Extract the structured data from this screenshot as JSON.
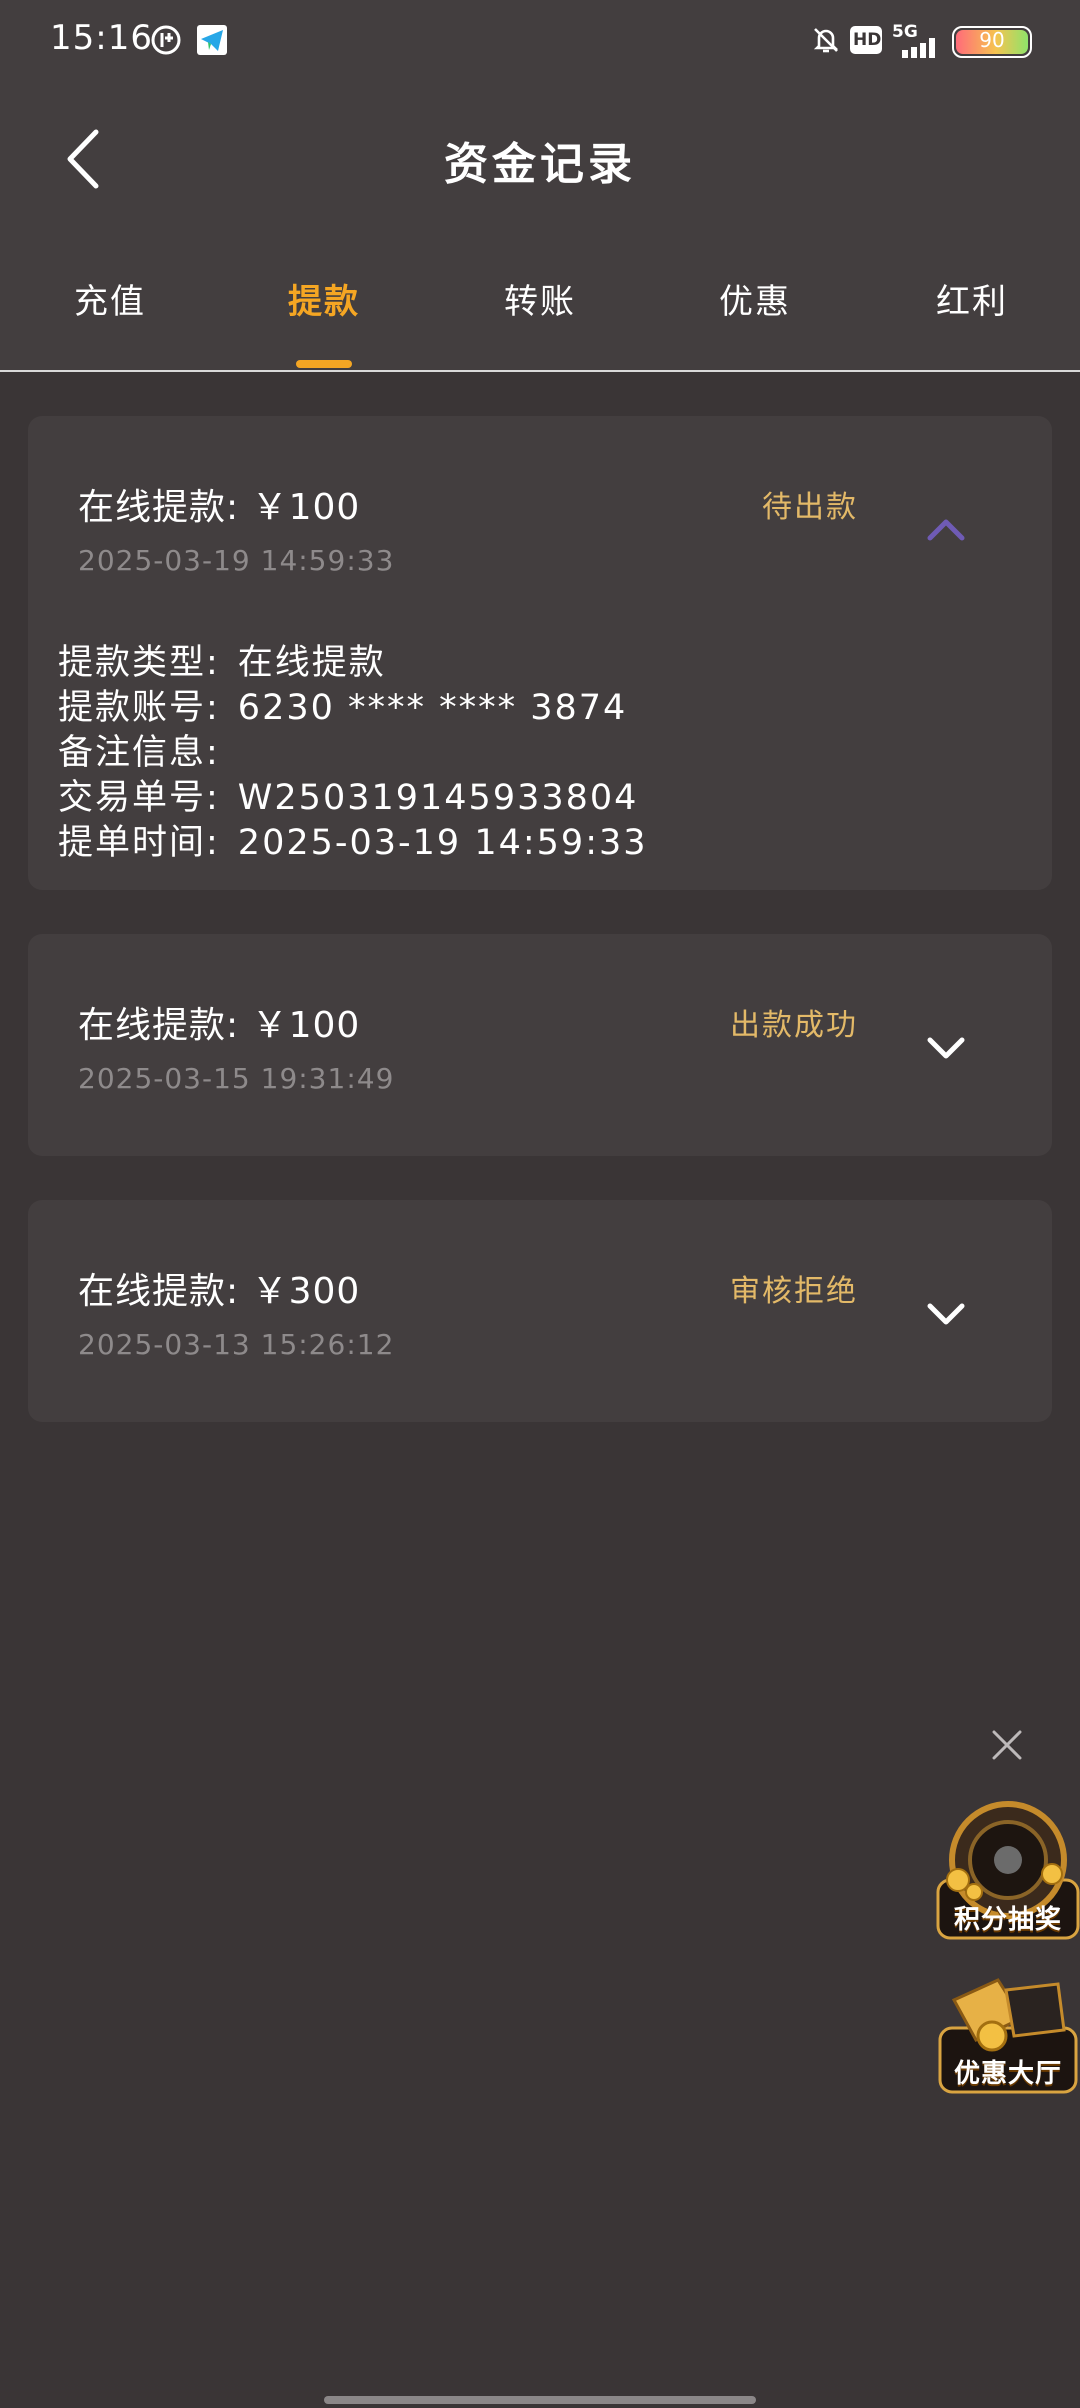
{
  "status_bar": {
    "time": "15:16",
    "battery": "90",
    "network": "5G",
    "hd": "HD"
  },
  "nav": {
    "title": "资金记录"
  },
  "tabs": [
    {
      "label": "充值"
    },
    {
      "label": "提款"
    },
    {
      "label": "转账"
    },
    {
      "label": "优惠"
    },
    {
      "label": "红利"
    }
  ],
  "records": [
    {
      "title": "在线提款: ￥100",
      "time": "2025-03-19 14:59:33",
      "status": "待出款",
      "expanded": true,
      "details": [
        {
          "label": "提款类型:",
          "value": "在线提款"
        },
        {
          "label": "提款账号:",
          "value": "6230 **** **** 3874"
        },
        {
          "label": "备注信息:",
          "value": ""
        },
        {
          "label": "交易单号:",
          "value": "W250319145933804"
        },
        {
          "label": "提单时间:",
          "value": "2025-03-19 14:59:33"
        }
      ]
    },
    {
      "title": "在线提款: ￥100",
      "time": "2025-03-15 19:31:49",
      "status": "出款成功",
      "expanded": false
    },
    {
      "title": "在线提款: ￥300",
      "time": "2025-03-13 15:26:12",
      "status": "审核拒绝",
      "expanded": false
    }
  ],
  "floating": [
    {
      "label": "积分抽奖",
      "icon": "lottery-wheel-icon"
    },
    {
      "label": "优惠大厅",
      "icon": "promotion-hall-icon"
    }
  ],
  "colors": {
    "accent": "#f5a623",
    "status_text": "#e3b968",
    "background": "#3a3536",
    "card": "#433e3f",
    "expanded_chevron": "#6f5bb5"
  }
}
